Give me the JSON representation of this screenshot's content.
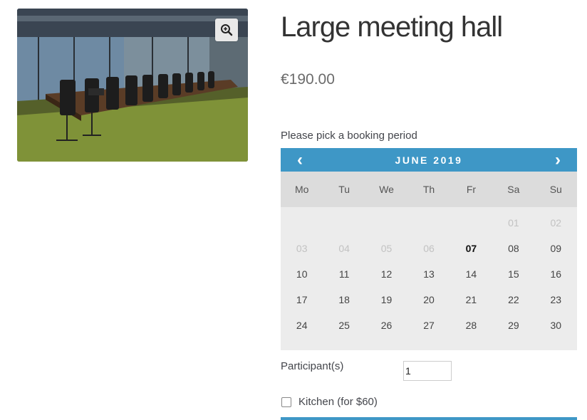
{
  "product": {
    "title": "Large meeting hall",
    "price": "€190.00",
    "image_icon": "meeting-room-photo",
    "zoom_icon": "zoom-in-icon"
  },
  "booking": {
    "label": "Please pick a booking period",
    "calendar": {
      "month_label": "JUNE 2019",
      "prev_glyph": "‹",
      "next_glyph": "›",
      "weekdays": [
        "Mo",
        "Tu",
        "We",
        "Th",
        "Fr",
        "Sa",
        "Su"
      ],
      "leading_blanks": 5,
      "days": [
        "01",
        "02",
        "03",
        "04",
        "05",
        "06",
        "07",
        "08",
        "09",
        "10",
        "11",
        "12",
        "13",
        "14",
        "15",
        "16",
        "17",
        "18",
        "19",
        "20",
        "21",
        "22",
        "23",
        "24",
        "25",
        "26",
        "27",
        "28",
        "29",
        "30"
      ],
      "past_days": [
        "01",
        "02",
        "03",
        "04",
        "05",
        "06"
      ],
      "today": "07"
    }
  },
  "participants": {
    "label": "Participant(s)",
    "value": "1"
  },
  "kitchen": {
    "label": "Kitchen (for $60)",
    "checked": false
  },
  "colors": {
    "accent": "#3e97c6",
    "calendar_bg": "#ececec"
  }
}
